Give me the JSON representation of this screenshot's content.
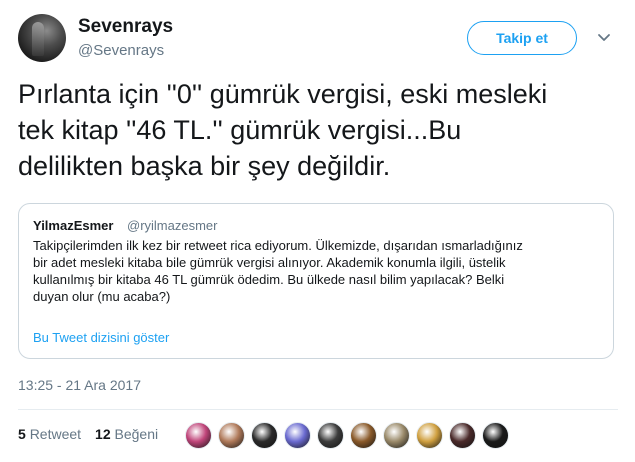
{
  "author": {
    "display_name": "Sevenrays",
    "handle": "@Sevenrays",
    "avatar_icon": "profile-photo"
  },
  "follow_button": {
    "label": "Takip et",
    "color": "#1da1f2"
  },
  "menu_caret": {
    "icon": "chevron-down-icon"
  },
  "tweet": {
    "text": "Pırlanta için ''0'' gümrük vergisi, eski mesleki\ntek kitap ''46 TL.'' gümrük vergisi...Bu\ndelilikten başka bir şey değildir."
  },
  "quoted_tweet": {
    "display_name": "YilmazEsmer",
    "handle": "@ryilmazesmer",
    "text": "Takipçilerimden ilk kez bir retweet rica ediyorum. Ülkemizde, dışarıdan ısmarladığınız\nbir adet mesleki kitaba bile gümrük vergisi alınıyor. Akademik konumla ilgili, üstelik\nkullanılmış bir kitaba 46 TL gümrük ödedim. Bu ülkede nasıl bilim yapılacak? Belki\nduyan olur (mu acaba?)",
    "thread_link": "Bu Tweet dizisini göster"
  },
  "timestamp": "13:25 - 21 Ara 2017",
  "stats": {
    "retweets_count": "5",
    "retweets_label": "Retweet",
    "likes_count": "12",
    "likes_label": "Beğeni"
  },
  "likers": [
    {
      "color": "#c0457a"
    },
    {
      "color": "#b07a5a"
    },
    {
      "color": "#2a2a2a"
    },
    {
      "color": "#6a6ad0"
    },
    {
      "color": "#3c3c3c"
    },
    {
      "color": "#8a5a2a"
    },
    {
      "color": "#9a8a6a"
    },
    {
      "color": "#d0a040"
    },
    {
      "color": "#4a2a2a"
    },
    {
      "color": "#1a1a1a"
    }
  ]
}
